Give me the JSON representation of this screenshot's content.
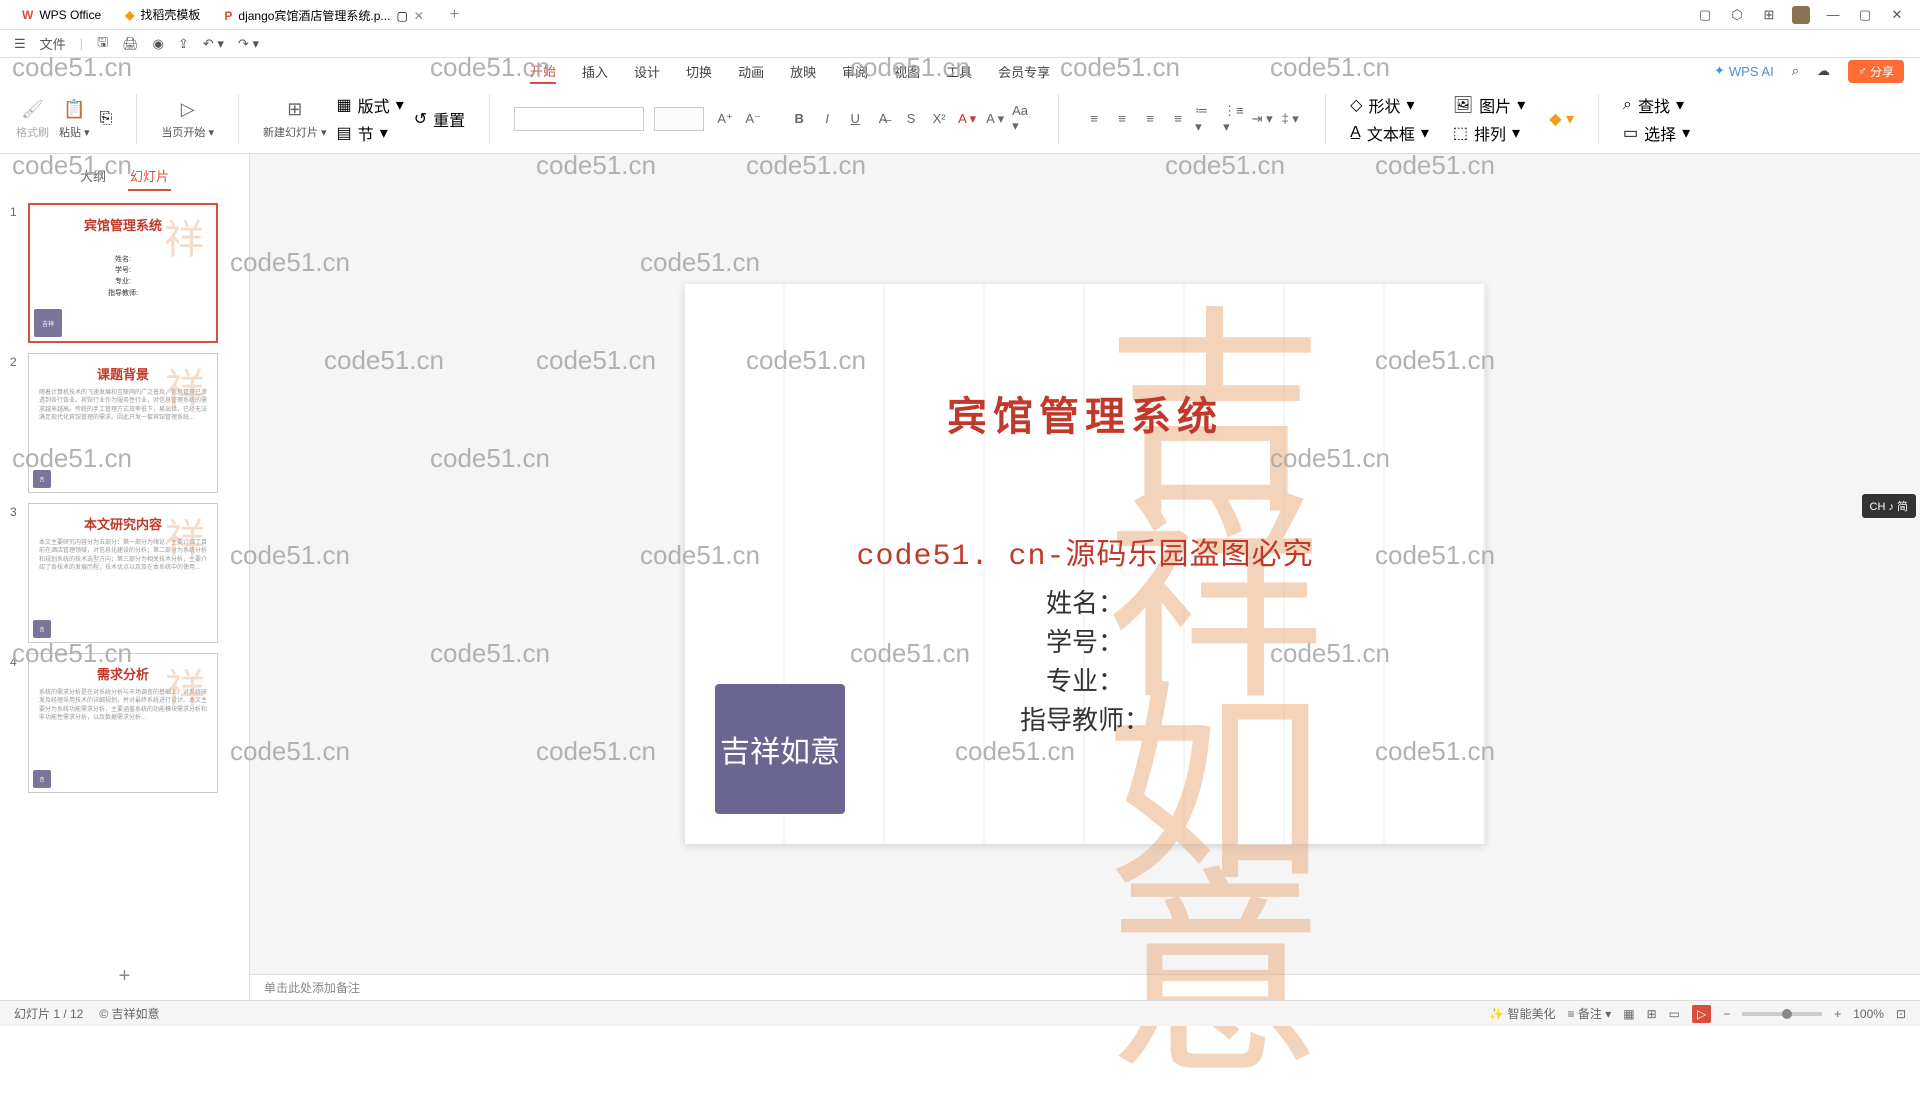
{
  "tabs": {
    "app": "WPS Office",
    "template": "找稻壳模板",
    "doc": "django宾馆酒店管理系统.p...",
    "add": "+"
  },
  "file_menu": "文件",
  "menu": [
    "开始",
    "插入",
    "设计",
    "切换",
    "动画",
    "放映",
    "审阅",
    "视图",
    "工具",
    "会员专享"
  ],
  "menu_active": 0,
  "wps_ai": "WPS AI",
  "share": "分享",
  "ribbon": {
    "format_painter": "格式刷",
    "paste": "粘贴",
    "from_beginning": "当页开始",
    "new_slide": "新建幻灯片",
    "layout": "版式",
    "section": "节",
    "reset": "重置",
    "shape": "形状",
    "picture": "图片",
    "textbox": "文本框",
    "arrange": "排列",
    "find": "查找",
    "select": "选择"
  },
  "panel": {
    "outline": "大纲",
    "slides": "幻灯片"
  },
  "thumbnails": [
    {
      "num": "1",
      "title": "宾馆管理系统",
      "fields": "姓名:\n学号:\n专业:\n指导教师:",
      "active": true,
      "seal_big": true
    },
    {
      "num": "2",
      "title": "课题背景",
      "body": true,
      "seal": true
    },
    {
      "num": "3",
      "title": "本文研究内容",
      "body": true,
      "seal": true
    },
    {
      "num": "4",
      "title": "需求分析",
      "body": true,
      "seal": true
    }
  ],
  "slide": {
    "title": "宾馆管理系统",
    "subtitle": "code51. cn-源码乐园盗图必究",
    "fields": [
      "姓名：",
      "学号：",
      "专业：",
      "指导教师："
    ],
    "seal": "吉祥如意"
  },
  "notes_placeholder": "单击此处添加备注",
  "status": {
    "left": "幻灯片 1 / 12",
    "theme": "© 吉祥如意",
    "smart": "智能美化",
    "notes": "备注",
    "zoom": "100%"
  },
  "ime": "CH ♪ 简",
  "watermark": "code51.cn"
}
